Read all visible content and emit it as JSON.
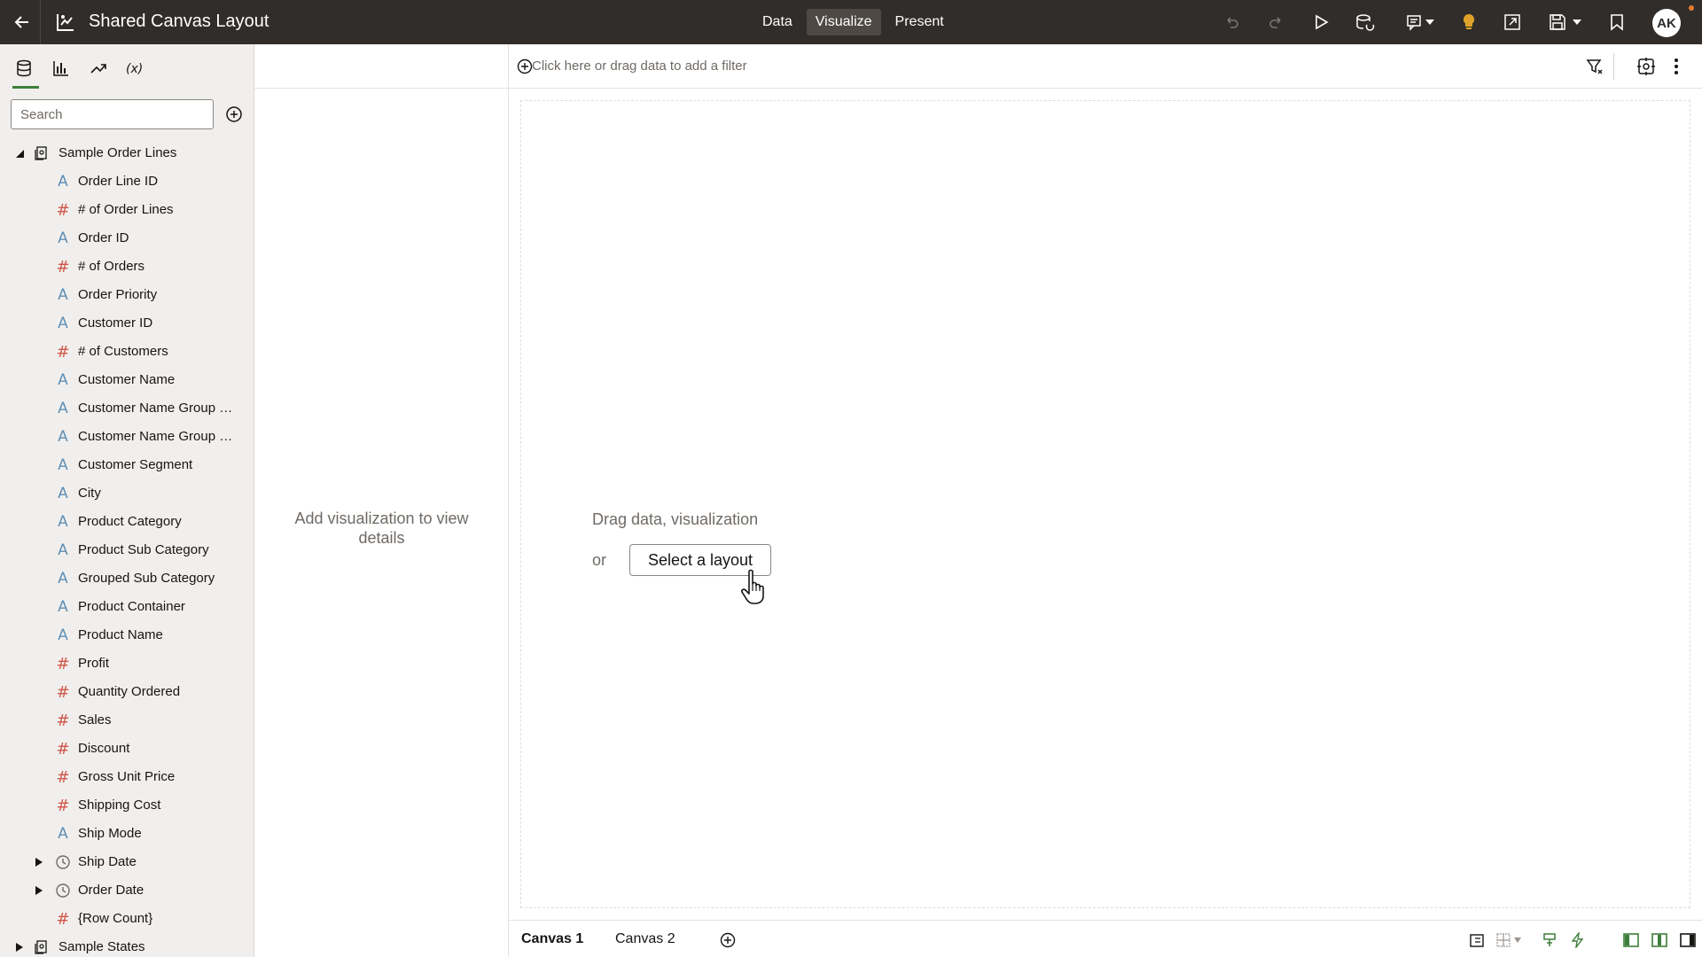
{
  "app": {
    "title": "Shared Canvas Layout",
    "modes": [
      {
        "label": "Data",
        "active": false
      },
      {
        "label": "Visualize",
        "active": true
      },
      {
        "label": "Present",
        "active": false
      }
    ],
    "user_initials": "AK",
    "colors": {
      "topbar": "#312d2a",
      "accent": "#3d7f3a",
      "attribute": "#5f8fb5",
      "measure": "#d0574a",
      "lightbulb": "#e0a22a"
    }
  },
  "toolbar_icons": [
    "undo-icon",
    "redo-icon",
    "play-icon",
    "data-refresh-icon",
    "comment-icon",
    "lightbulb-icon",
    "export-icon",
    "save-icon",
    "bookmark-icon"
  ],
  "left_panel": {
    "tabs": [
      "data-icon",
      "visualizations-icon",
      "analytics-icon",
      "variables-icon"
    ],
    "search_placeholder": "Search",
    "dataset": {
      "name": "Sample Order Lines",
      "fields": [
        {
          "label": "Order Line ID",
          "kind": "attribute"
        },
        {
          "label": "# of Order Lines",
          "kind": "measure"
        },
        {
          "label": "Order ID",
          "kind": "attribute"
        },
        {
          "label": "# of Orders",
          "kind": "measure"
        },
        {
          "label": "Order Priority",
          "kind": "attribute"
        },
        {
          "label": "Customer ID",
          "kind": "attribute"
        },
        {
          "label": "# of Customers",
          "kind": "measure"
        },
        {
          "label": "Customer Name",
          "kind": "attribute"
        },
        {
          "label": "Customer Name Group …",
          "kind": "attribute"
        },
        {
          "label": "Customer Name Group …",
          "kind": "attribute"
        },
        {
          "label": "Customer Segment",
          "kind": "attribute"
        },
        {
          "label": "City",
          "kind": "attribute"
        },
        {
          "label": "Product Category",
          "kind": "attribute"
        },
        {
          "label": "Product Sub Category",
          "kind": "attribute"
        },
        {
          "label": "Grouped Sub Category",
          "kind": "attribute"
        },
        {
          "label": "Product Container",
          "kind": "attribute"
        },
        {
          "label": "Product Name",
          "kind": "attribute"
        },
        {
          "label": "Profit",
          "kind": "measure"
        },
        {
          "label": "Quantity Ordered",
          "kind": "measure"
        },
        {
          "label": "Sales",
          "kind": "measure"
        },
        {
          "label": "Discount",
          "kind": "measure"
        },
        {
          "label": "Gross Unit Price",
          "kind": "measure"
        },
        {
          "label": "Shipping Cost",
          "kind": "measure"
        },
        {
          "label": "Ship Mode",
          "kind": "attribute"
        },
        {
          "label": "Ship Date",
          "kind": "date"
        },
        {
          "label": "Order Date",
          "kind": "date"
        },
        {
          "label": "{Row Count}",
          "kind": "measure"
        }
      ]
    },
    "dataset2": {
      "name": "Sample States"
    }
  },
  "properties_pane": {
    "message": "Add visualization to view details"
  },
  "filter_bar": {
    "placeholder": "Click here or drag data to add a filter"
  },
  "canvas": {
    "drop_hint": "Drag data, visualization",
    "or_text": "or",
    "select_layout_label": "Select a layout"
  },
  "bottom_tabs": [
    {
      "label": "Canvas 1",
      "active": true
    },
    {
      "label": "Canvas 2",
      "active": false
    }
  ]
}
